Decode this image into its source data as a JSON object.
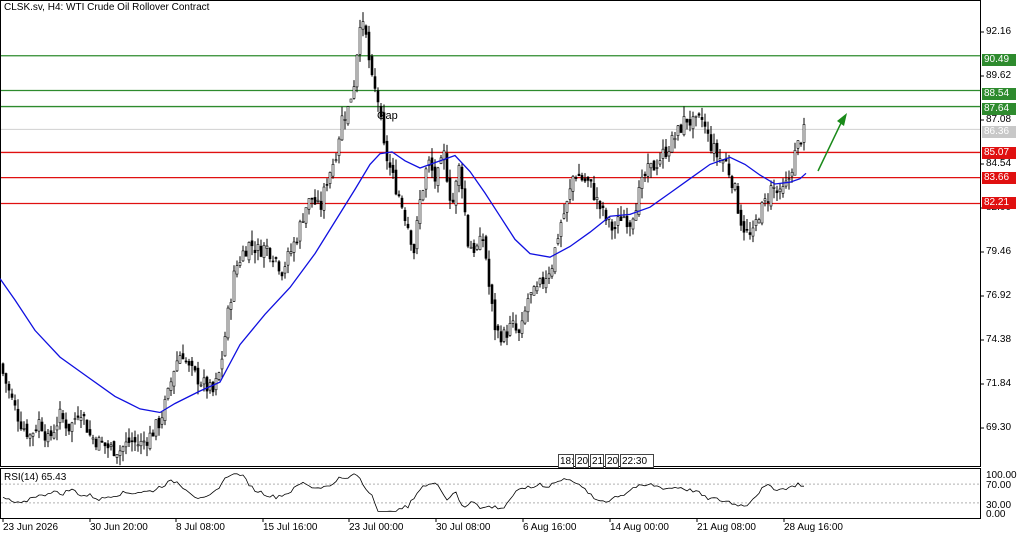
{
  "header": {
    "title": "CLSK.sv, H4:  WTI Crude Oil Rollover Contract"
  },
  "annotation": {
    "gap_label": "Gap"
  },
  "price_axis": {
    "ticks": [
      "92.16",
      "89.62",
      "87.08",
      "84.54",
      "82.00",
      "79.46",
      "76.92",
      "74.38",
      "71.84",
      "69.30"
    ]
  },
  "levels": {
    "green": [
      "90.49",
      "88.54",
      "87.64"
    ],
    "red": [
      "85.07",
      "83.66",
      "82.21"
    ],
    "current": "86.36",
    "green_color": "#2e8b2e",
    "red_color": "#e01010"
  },
  "rsi_panel": {
    "label": "RSI(14) 65.43",
    "ticks": [
      "100.00",
      "70.00",
      "30.00",
      "0.00"
    ]
  },
  "time_axis": {
    "labels": [
      "23 Jun 2026",
      "30 Jun 20:00",
      "8 Jul 08:00",
      "15 Jul 16:00",
      "23 Jul 00:00",
      "30 Jul 08:00",
      "6 Aug 16:00",
      "14 Aug 00:00",
      "21 Aug 08:00",
      "28 Aug 16:00"
    ]
  },
  "scroll_navigator": {
    "items": [
      "18:",
      "20",
      "21",
      "20",
      "22:30"
    ]
  },
  "colors": {
    "ma_line": "#1010e0",
    "candles": "#000000",
    "arrow": "#1a8a1a"
  },
  "chart_data": {
    "type": "candlestick",
    "title": "CLSK.sv, H4:  WTI Crude Oil Rollover Contract",
    "y_range": [
      67.5,
      93.5
    ],
    "x_labels": [
      "23 Jun 2026",
      "30 Jun 20:00",
      "8 Jul 08:00",
      "15 Jul 16:00",
      "23 Jul 00:00",
      "30 Jul 08:00",
      "6 Aug 16:00",
      "14 Aug 00:00",
      "21 Aug 08:00",
      "28 Aug 16:00"
    ],
    "close_path": [
      [
        0,
        73.2
      ],
      [
        10,
        71.5
      ],
      [
        20,
        70.0
      ],
      [
        30,
        69.2
      ],
      [
        40,
        70.1
      ],
      [
        48,
        68.9
      ],
      [
        60,
        70.3
      ],
      [
        70,
        69.6
      ],
      [
        80,
        70.8
      ],
      [
        90,
        69.2
      ],
      [
        100,
        68.8
      ],
      [
        110,
        68.5
      ],
      [
        120,
        68.4
      ],
      [
        130,
        68.9
      ],
      [
        140,
        68.7
      ],
      [
        150,
        69.2
      ],
      [
        160,
        70.0
      ],
      [
        168,
        71.5
      ],
      [
        175,
        73.2
      ],
      [
        182,
        74.0
      ],
      [
        188,
        73.0
      ],
      [
        195,
        72.6
      ],
      [
        205,
        72.0
      ],
      [
        213,
        71.6
      ],
      [
        220,
        72.8
      ],
      [
        228,
        76.0
      ],
      [
        235,
        78.5
      ],
      [
        242,
        79.4
      ],
      [
        250,
        80.0
      ],
      [
        258,
        79.6
      ],
      [
        266,
        79.8
      ],
      [
        274,
        79.3
      ],
      [
        282,
        78.5
      ],
      [
        290,
        79.4
      ],
      [
        298,
        80.5
      ],
      [
        305,
        82.0
      ],
      [
        312,
        82.5
      ],
      [
        320,
        81.8
      ],
      [
        328,
        83.8
      ],
      [
        335,
        84.8
      ],
      [
        342,
        87.0
      ],
      [
        348,
        87.5
      ],
      [
        354,
        89.0
      ],
      [
        360,
        92.5
      ],
      [
        366,
        91.5
      ],
      [
        372,
        89.0
      ],
      [
        378,
        88.0
      ],
      [
        384,
        85.3
      ],
      [
        392,
        83.8
      ],
      [
        400,
        82.5
      ],
      [
        408,
        81.0
      ],
      [
        414,
        79.6
      ],
      [
        420,
        82.3
      ],
      [
        428,
        84.6
      ],
      [
        436,
        83.4
      ],
      [
        444,
        84.9
      ],
      [
        452,
        82.0
      ],
      [
        460,
        84.5
      ],
      [
        468,
        80.0
      ],
      [
        476,
        79.6
      ],
      [
        484,
        80.3
      ],
      [
        490,
        77.0
      ],
      [
        496,
        75.0
      ],
      [
        504,
        74.8
      ],
      [
        512,
        75.4
      ],
      [
        520,
        74.7
      ],
      [
        528,
        76.9
      ],
      [
        536,
        77.2
      ],
      [
        544,
        78.0
      ],
      [
        552,
        78.8
      ],
      [
        560,
        81.0
      ],
      [
        568,
        82.3
      ],
      [
        574,
        84.0
      ],
      [
        582,
        83.6
      ],
      [
        590,
        83.3
      ],
      [
        598,
        82.2
      ],
      [
        606,
        81.3
      ],
      [
        614,
        80.7
      ],
      [
        622,
        81.6
      ],
      [
        630,
        81.2
      ],
      [
        638,
        82.6
      ],
      [
        646,
        83.9
      ],
      [
        654,
        84.3
      ],
      [
        662,
        84.9
      ],
      [
        670,
        85.5
      ],
      [
        678,
        86.2
      ],
      [
        686,
        87.0
      ],
      [
        694,
        86.6
      ],
      [
        702,
        86.9
      ],
      [
        710,
        85.6
      ],
      [
        718,
        84.8
      ],
      [
        726,
        84.5
      ],
      [
        734,
        83.2
      ],
      [
        740,
        81.4
      ],
      [
        746,
        80.6
      ],
      [
        752,
        80.2
      ],
      [
        758,
        81.6
      ],
      [
        764,
        82.1
      ],
      [
        772,
        83.2
      ],
      [
        780,
        82.6
      ],
      [
        788,
        83.4
      ],
      [
        794,
        84.8
      ],
      [
        800,
        85.8
      ],
      [
        806,
        86.4
      ]
    ],
    "ma_path": [
      [
        0,
        78.0
      ],
      [
        15,
        76.8
      ],
      [
        35,
        75.1
      ],
      [
        60,
        73.6
      ],
      [
        90,
        72.4
      ],
      [
        115,
        71.4
      ],
      [
        140,
        70.7
      ],
      [
        160,
        70.5
      ],
      [
        175,
        71.0
      ],
      [
        200,
        71.7
      ],
      [
        220,
        72.2
      ],
      [
        240,
        74.3
      ],
      [
        265,
        76.0
      ],
      [
        290,
        77.5
      ],
      [
        315,
        79.4
      ],
      [
        335,
        81.2
      ],
      [
        355,
        83.0
      ],
      [
        370,
        84.4
      ],
      [
        380,
        85.0
      ],
      [
        392,
        85.1
      ],
      [
        405,
        84.6
      ],
      [
        420,
        84.2
      ],
      [
        435,
        84.5
      ],
      [
        455,
        84.9
      ],
      [
        470,
        84.0
      ],
      [
        485,
        82.8
      ],
      [
        500,
        81.5
      ],
      [
        515,
        80.2
      ],
      [
        530,
        79.4
      ],
      [
        550,
        79.2
      ],
      [
        570,
        79.8
      ],
      [
        590,
        80.6
      ],
      [
        610,
        81.5
      ],
      [
        630,
        81.6
      ],
      [
        650,
        82.0
      ],
      [
        670,
        82.8
      ],
      [
        690,
        83.6
      ],
      [
        710,
        84.4
      ],
      [
        730,
        84.8
      ],
      [
        745,
        84.4
      ],
      [
        760,
        83.8
      ],
      [
        775,
        83.3
      ],
      [
        790,
        83.4
      ],
      [
        800,
        83.6
      ],
      [
        806,
        83.9
      ]
    ],
    "horizontal_levels": {
      "resistance_green": [
        90.49,
        88.54,
        87.64
      ],
      "support_red": [
        85.07,
        83.66,
        82.21
      ]
    },
    "current_price": 86.36,
    "rsi": {
      "label": "RSI(14) 65.43",
      "last": 65.43,
      "y_range": [
        0,
        100
      ],
      "levels": [
        70,
        30
      ]
    }
  }
}
